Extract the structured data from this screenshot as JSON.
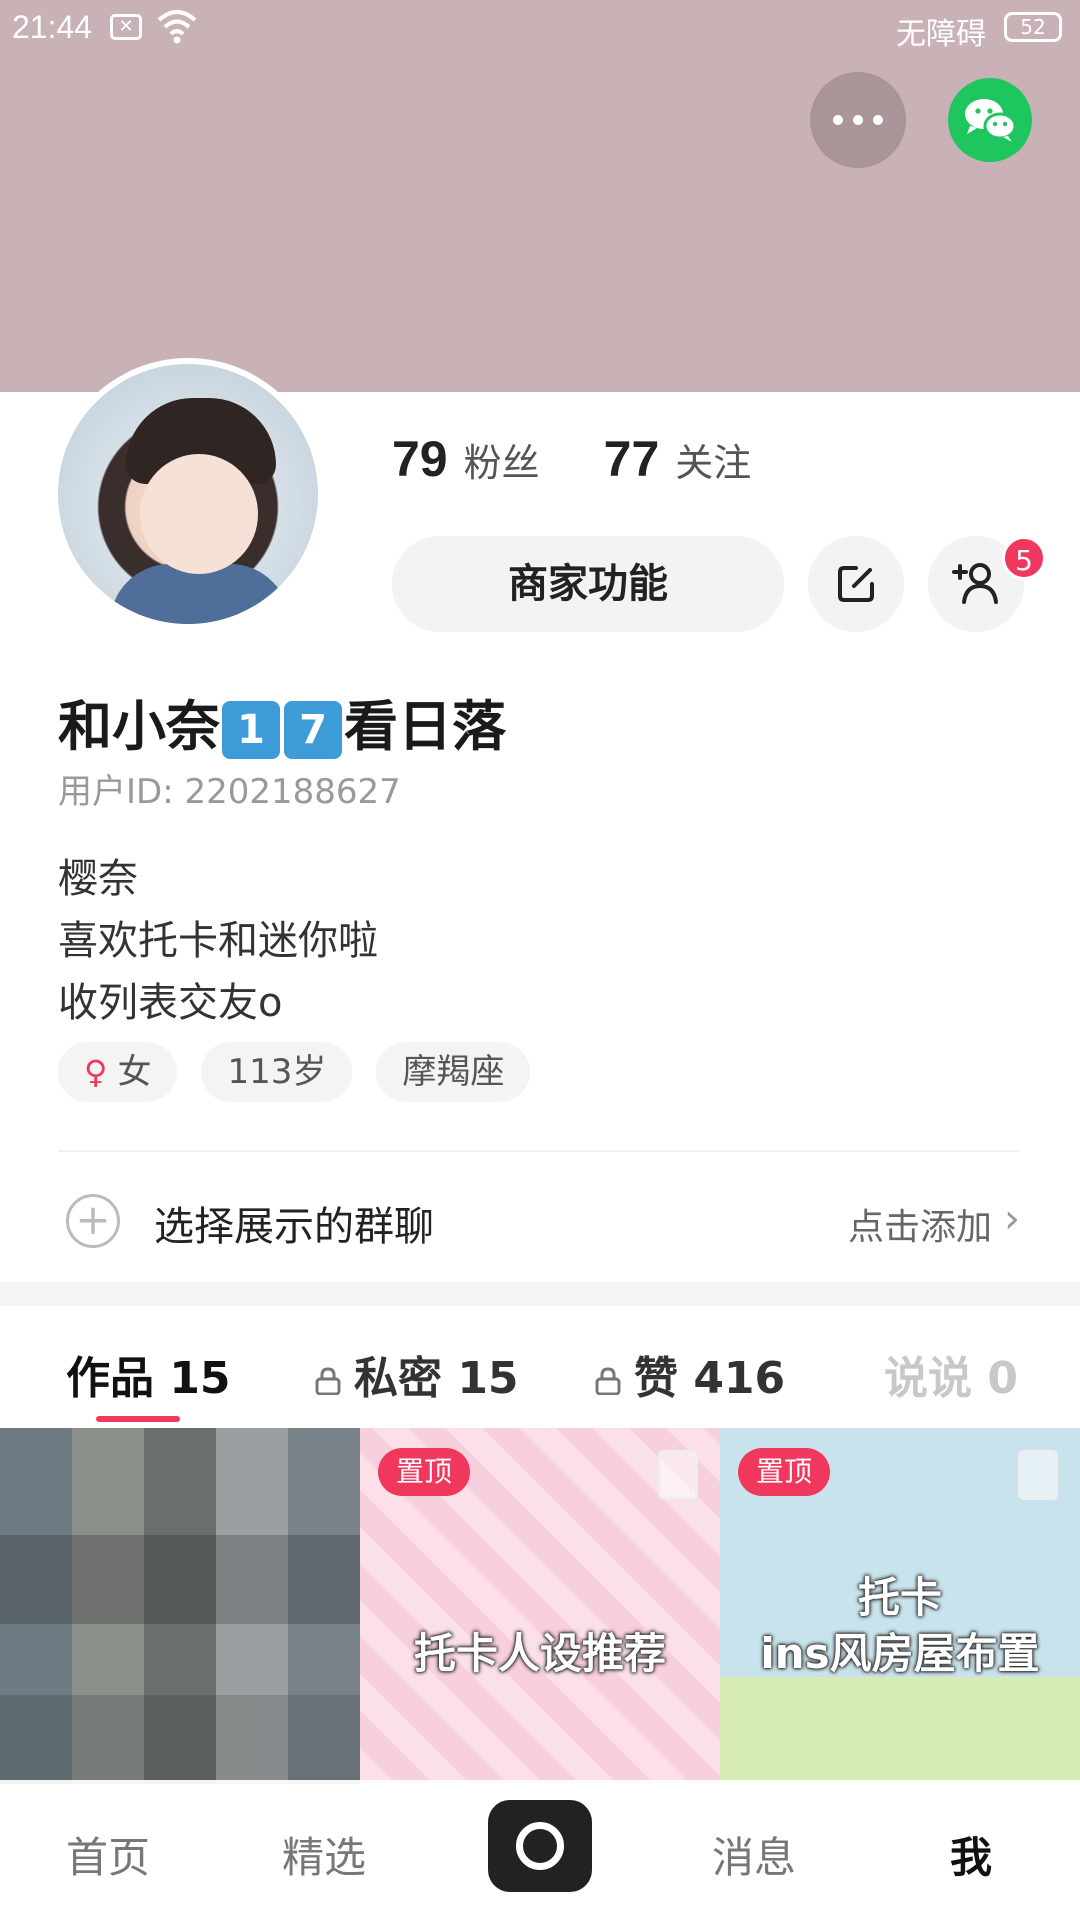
{
  "status_bar": {
    "time": "21:44",
    "accessibility": "无障碍",
    "battery": "52"
  },
  "profile": {
    "fans_count": "79",
    "fans_label": "粉丝",
    "following_count": "77",
    "following_label": "关注",
    "business_button": "商家功能",
    "friend_badge": "5",
    "name_prefix": "和小奈",
    "name_key_1": "1",
    "name_key_2": "7",
    "name_suffix": "看日落",
    "user_id": "用户ID: 2202188627",
    "bio_lines": [
      "樱奈",
      "喜欢托卡和迷你啦",
      "收列表交友o"
    ],
    "gender": "女",
    "age": "113岁",
    "zodiac": "摩羯座"
  },
  "group_chat": {
    "label": "选择展示的群聊",
    "action": "点击添加"
  },
  "tabs": [
    {
      "label": "作品 15"
    },
    {
      "label": "私密 15"
    },
    {
      "label": "赞 416"
    },
    {
      "label": "说说 0"
    }
  ],
  "posts": [
    {
      "pinned": "",
      "title": ""
    },
    {
      "pinned": "置顶",
      "title": "托卡人设推荐"
    },
    {
      "pinned": "置顶",
      "title_line1": "托卡",
      "title_line2": "ins风房屋布置"
    }
  ],
  "bottom_nav": {
    "home": "首页",
    "featured": "精选",
    "messages": "消息",
    "me": "我"
  },
  "colors": {
    "accent": "#f0385e",
    "cover": "#c9b2b5",
    "wechat": "#1fc660"
  }
}
